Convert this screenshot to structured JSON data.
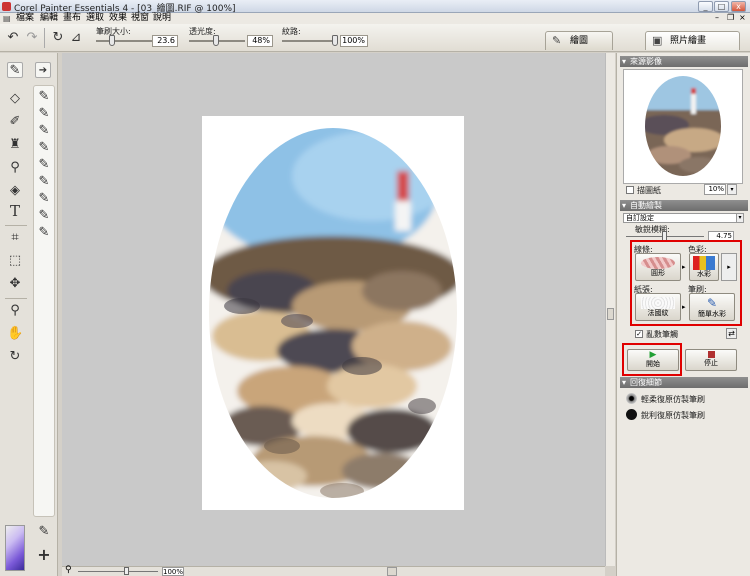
{
  "window": {
    "title": "Corel Painter Essentials 4 - [03_繪圖.RIF @ 100%]",
    "minimize": "_",
    "maximize": "□",
    "close": "x"
  },
  "menubar": {
    "items": [
      {
        "label": "檔案"
      },
      {
        "label": "編輯"
      },
      {
        "label": "畫布"
      },
      {
        "label": "選取"
      },
      {
        "label": "效果"
      },
      {
        "label": "視窗"
      },
      {
        "label": "說明"
      }
    ]
  },
  "toolbar": {
    "brush_size_label": "筆刷大小:",
    "brush_size_value": "23.6",
    "brush_size_level": 0.25,
    "opacity_label": "透光度:",
    "opacity_value": "48%",
    "opacity_level": 0.48,
    "grain_label": "紋路:",
    "grain_value": "100%",
    "grain_level": 1.0
  },
  "mode_tabs": [
    {
      "label": "繪圖",
      "icon": "brush-icon",
      "active": false
    },
    {
      "label": "照片繪畫",
      "icon": "photo-painting-icon",
      "active": true
    }
  ],
  "source_panel": {
    "title": "來源影像",
    "tracing_paper_label": "描圖紙",
    "opacity_value": "10%"
  },
  "auto_paint_panel": {
    "title": "自動繪製",
    "preset_value": "自訂設定",
    "sensitivity_label": "敏銳模糊:",
    "sensitivity_value": "4.75",
    "stroke_label": "線條:",
    "stroke_value": "圓形",
    "color_label": "色彩:",
    "color_value": "水彩",
    "paper_label": "紙張:",
    "paper_value": "法國紋",
    "brush_label": "筆刷:",
    "brush_value": "簡單水彩",
    "random_stroke_label": "亂數筆觸",
    "random_stroke_checked": true,
    "start_label": "開始",
    "stop_label": "停止"
  },
  "restore_panel": {
    "title": "回復細節",
    "soft_label": "輕柔復原仿製筆刷",
    "hard_label": "銳利復原仿製筆刷"
  },
  "status": {
    "zoom_value": "100%"
  },
  "colors": {
    "highlight": "#e00000",
    "panel_header": "#7a7a7a",
    "start_icon": "#22a035",
    "stop_icon": "#b03030"
  }
}
